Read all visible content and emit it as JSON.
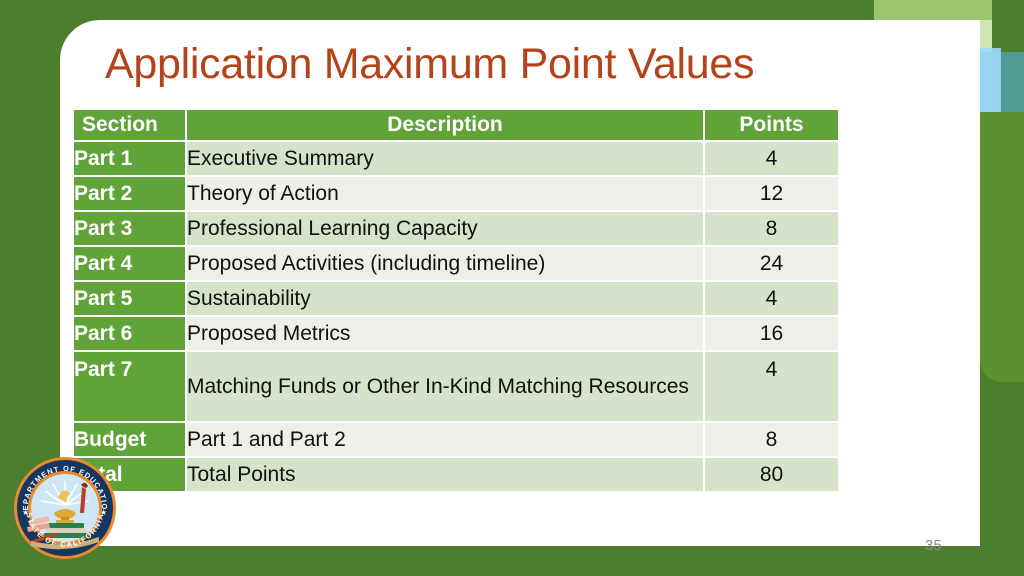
{
  "slide": {
    "title": "Application Maximum Point Values",
    "number": "35",
    "title_color": "#b4431a",
    "background_color": "#4b7f2e",
    "card_color": "#ffffff",
    "table_header_color": "#60a338",
    "row_tint_a": "#d5e3cb",
    "row_tint_b": "#ecf0e9"
  },
  "table": {
    "headers": {
      "section": "Section",
      "description": "Description",
      "points": "Points"
    },
    "rows": [
      {
        "section": "Part 1",
        "description": "Executive Summary",
        "points": "4"
      },
      {
        "section": "Part 2",
        "description": "Theory of Action",
        "points": "12"
      },
      {
        "section": "Part 3",
        "description": "Professional Learning Capacity",
        "points": "8"
      },
      {
        "section": "Part 4",
        "description": "Proposed Activities (including timeline)",
        "points": "24"
      },
      {
        "section": "Part 5",
        "description": "Sustainability",
        "points": "4"
      },
      {
        "section": "Part 6",
        "description": "Proposed Metrics",
        "points": "16"
      },
      {
        "section": "Part 7",
        "description": "Matching Funds or Other In-Kind Matching Resources",
        "points": "4"
      },
      {
        "section": "Budget",
        "description": "Part 1 and Part 2",
        "points": "8"
      },
      {
        "section": "Total",
        "description": "Total Points",
        "points": "80"
      }
    ]
  },
  "seal": {
    "name": "california-department-of-education-seal",
    "outer_text_top": "DEPARTMENT OF EDUCATION",
    "outer_text_bottom": "STATE OF CALIFORNIA"
  }
}
